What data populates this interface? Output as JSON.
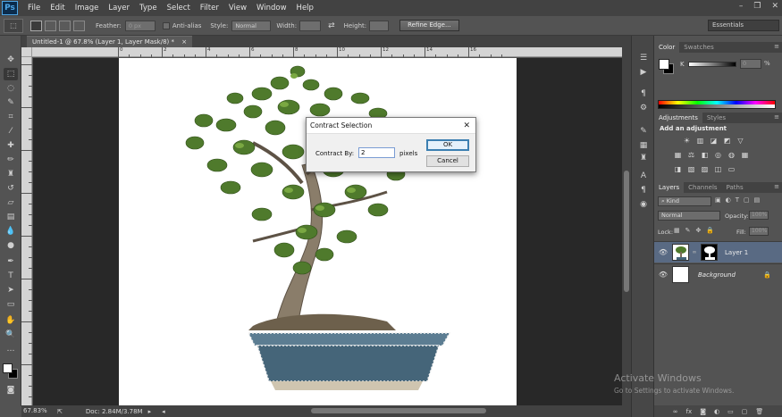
{
  "app": {
    "logo": "Ps"
  },
  "menu": [
    "File",
    "Edit",
    "Image",
    "Layer",
    "Type",
    "Select",
    "Filter",
    "View",
    "Window",
    "Help"
  ],
  "window_controls": {
    "minimize": "–",
    "restore": "❐",
    "close": "✕"
  },
  "options_bar": {
    "feather_label": "Feather:",
    "feather_value": "0 px",
    "antialias_label": "Anti-alias",
    "style_label": "Style:",
    "style_value": "Normal",
    "width_label": "Width:",
    "height_label": "Height:",
    "refine_edge": "Refine Edge...",
    "workspace": "Essentials"
  },
  "document": {
    "tab_title": "Untitled-1 @ 67.8% (Layer 1, Layer Mask/8) *",
    "tab_close": "×",
    "zoom": "67.83%",
    "doc_info": "Doc: 2.84M/3.78M"
  },
  "rulers": {
    "top_labels": [
      "0",
      "2",
      "4",
      "6",
      "8",
      "10",
      "12",
      "14",
      "16"
    ]
  },
  "dialog": {
    "title": "Contract Selection",
    "close": "✕",
    "label": "Contract By:",
    "value": "2",
    "unit": "pixels",
    "ok": "OK",
    "cancel": "Cancel"
  },
  "color_panel": {
    "tabs": [
      "Color",
      "Swatches"
    ],
    "k_label": "K",
    "k_value": "0",
    "k_unit": "%"
  },
  "adjustments_panel": {
    "tabs": [
      "Adjustments",
      "Styles"
    ],
    "title": "Add an adjustment"
  },
  "layers_panel": {
    "tabs": [
      "Layers",
      "Channels",
      "Paths"
    ],
    "kind_label": "Kind",
    "blend_mode": "Normal",
    "opacity_label": "Opacity:",
    "opacity_value": "100%",
    "lock_label": "Lock:",
    "fill_label": "Fill:",
    "fill_value": "100%",
    "layers": [
      {
        "name": "Layer 1",
        "selected": true
      },
      {
        "name": "Background",
        "selected": false
      }
    ]
  },
  "watermark": {
    "title": "Activate Windows",
    "subtitle": "Go to Settings to activate Windows."
  },
  "colors": {
    "accent": "#4fa7e6",
    "selected_layer": "#596a83",
    "chrome_dark": "#424242",
    "chrome": "#535353"
  }
}
